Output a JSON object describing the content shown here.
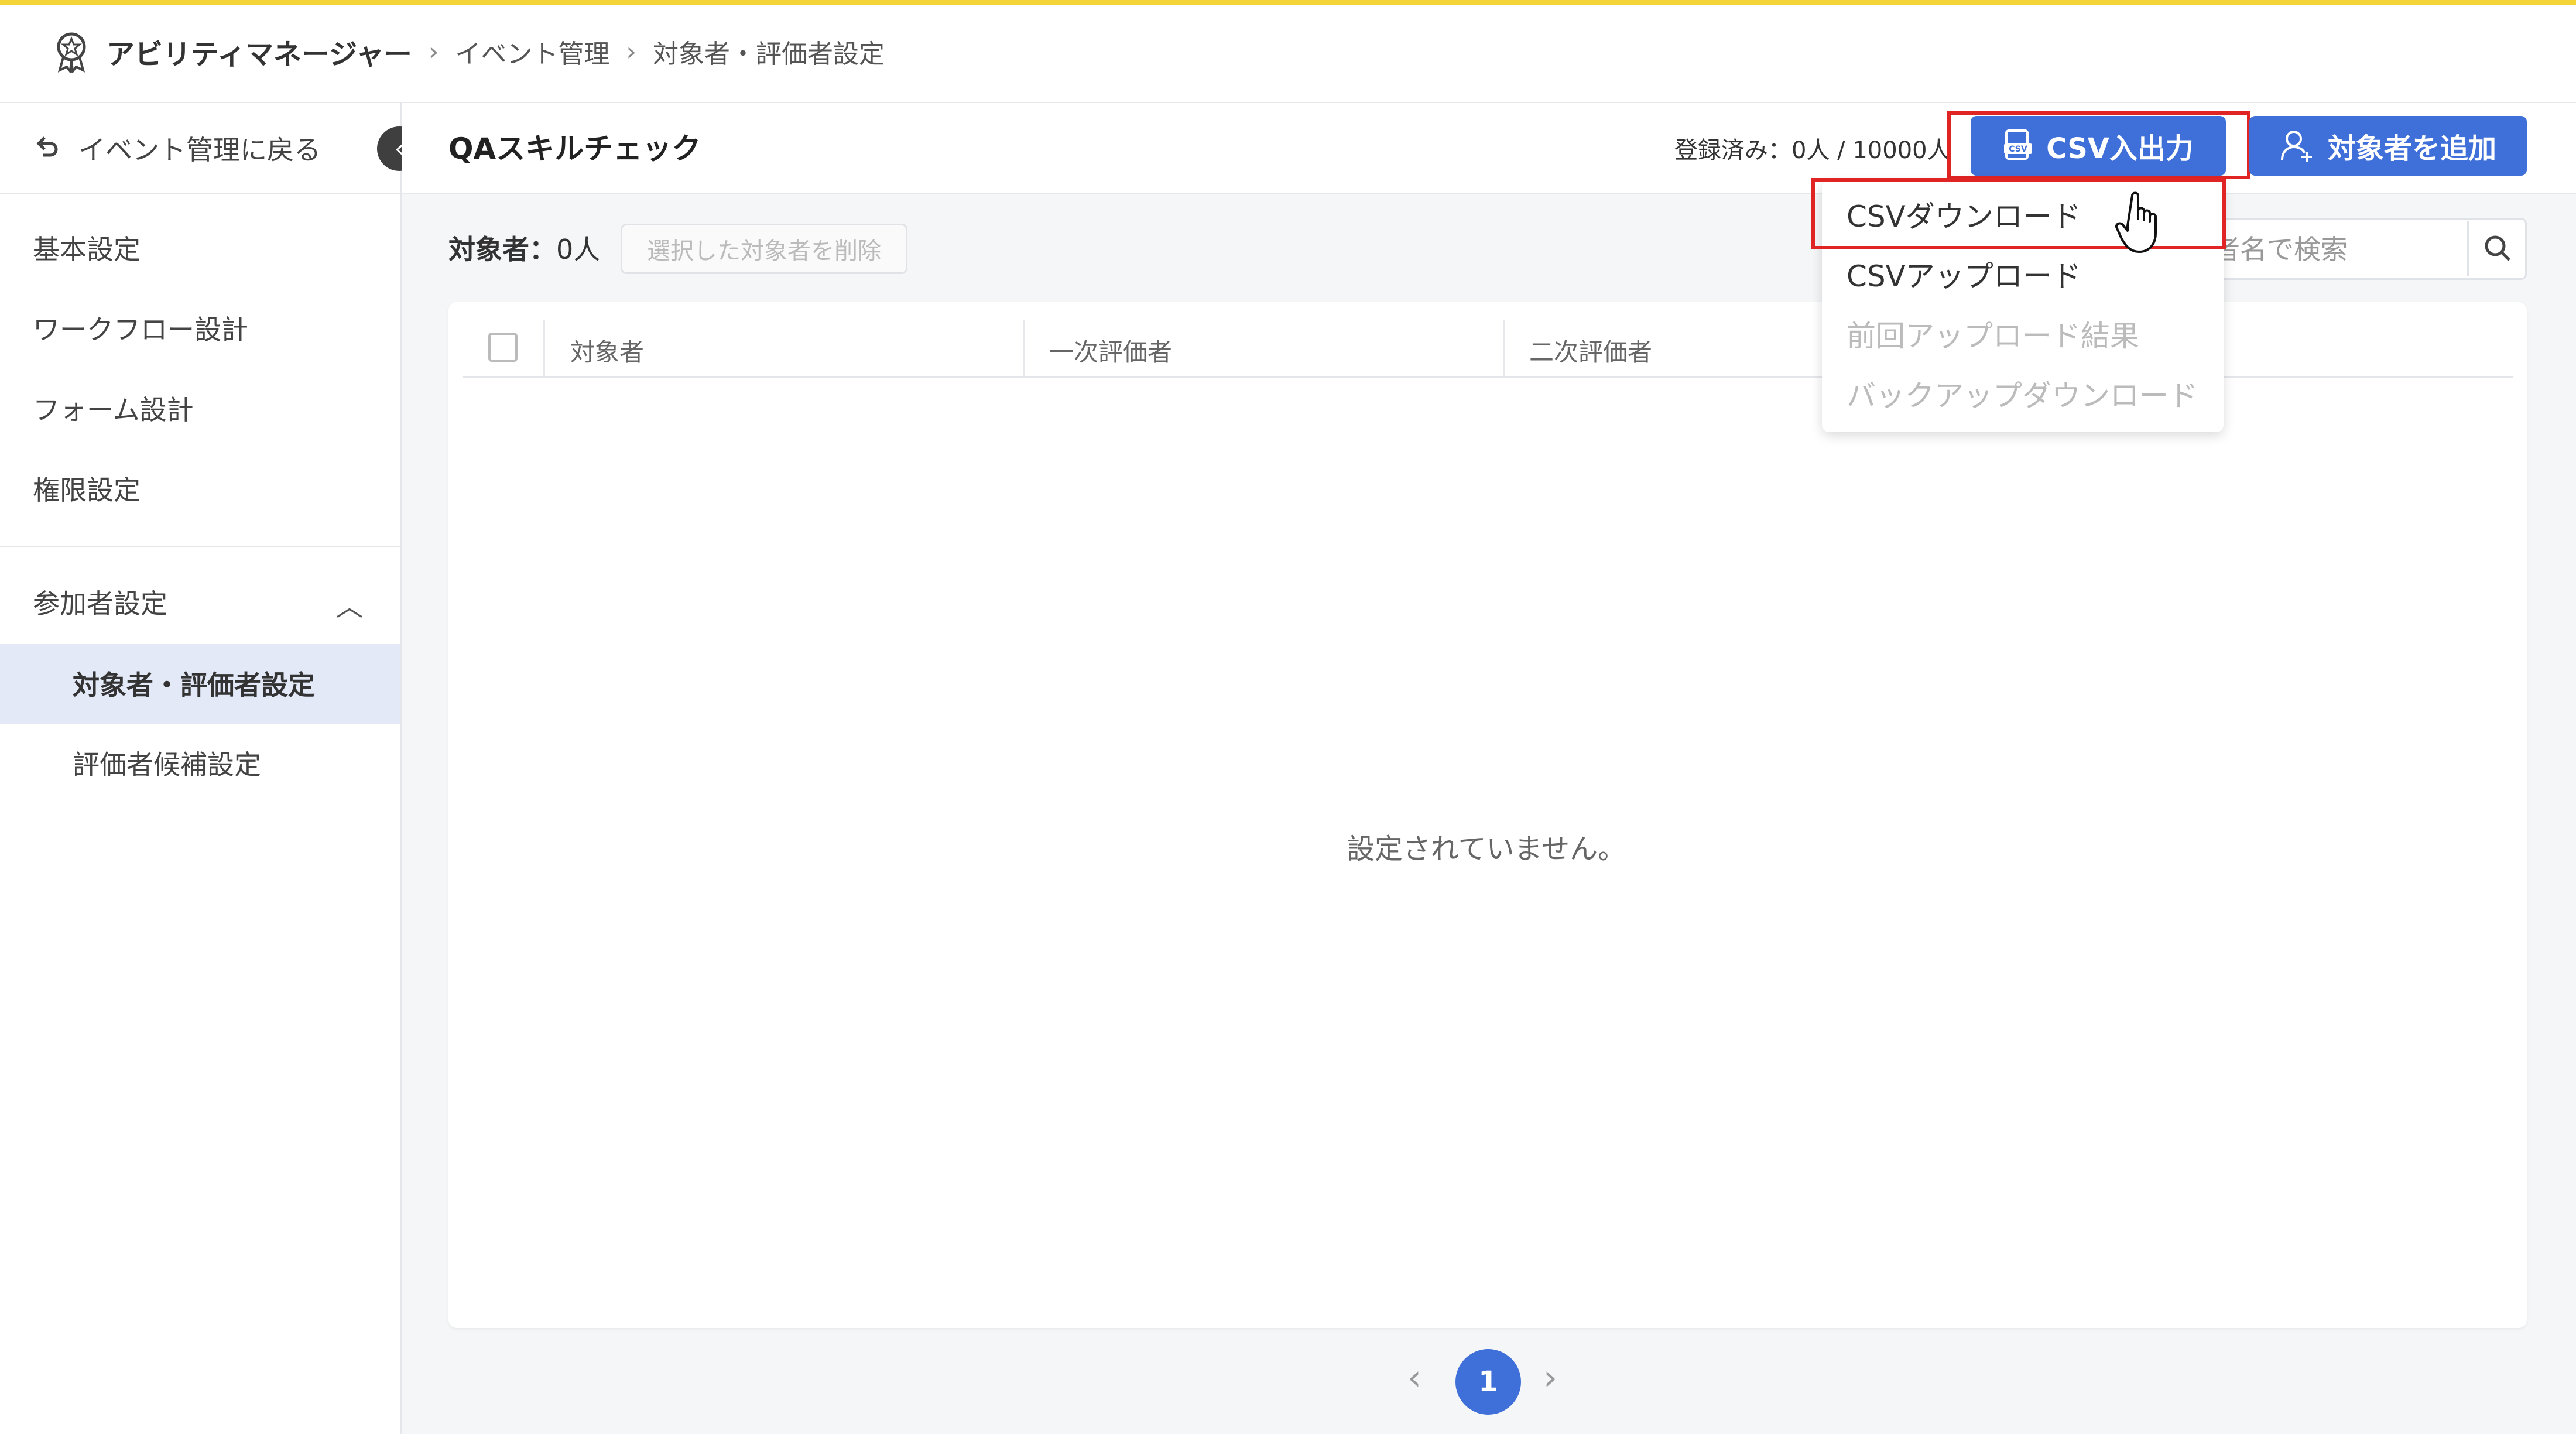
{
  "breadcrumb": {
    "app": "アビリティマネージャー",
    "level1": "イベント管理",
    "level2": "対象者・評価者設定"
  },
  "sidebar": {
    "back": "イベント管理に戻る",
    "items": [
      {
        "label": "基本設定"
      },
      {
        "label": "ワークフロー設計"
      },
      {
        "label": "フォーム設計"
      },
      {
        "label": "権限設定"
      }
    ],
    "group_label": "参加者設定",
    "sub_items": [
      {
        "label": "対象者・評価者設定",
        "active": true
      },
      {
        "label": "評価者候補設定",
        "active": false
      }
    ]
  },
  "header": {
    "title": "QAスキルチェック",
    "registered": "登録済み：0人 / 10000人",
    "csv_button": "CSV入出力",
    "add_button": "対象者を追加"
  },
  "toolbar": {
    "count_label": "対象者：",
    "count_value": "0人",
    "delete_button": "選択した対象者を削除",
    "search_placeholder": "者名で検索"
  },
  "table": {
    "columns": [
      "対象者",
      "一次評価者",
      "二次評価者"
    ],
    "empty_message": "設定されていません。"
  },
  "csv_menu": {
    "items": [
      {
        "label": "CSVダウンロード",
        "enabled": true
      },
      {
        "label": "CSVアップロード",
        "enabled": true
      },
      {
        "label": "前回アップロード結果",
        "enabled": false
      },
      {
        "label": "バックアップダウンロード",
        "enabled": false
      }
    ]
  },
  "pagination": {
    "current": "1"
  },
  "colors": {
    "accent": "#3f6fd8",
    "top_border": "#f5d43a",
    "highlight": "#e02424",
    "active_nav": "#e3e9f7"
  }
}
